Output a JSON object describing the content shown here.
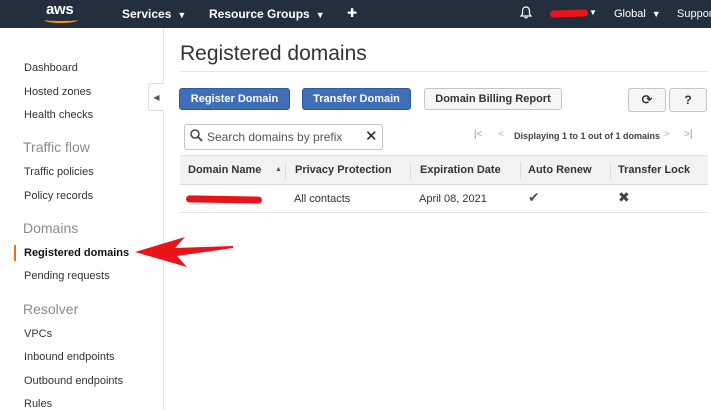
{
  "topnav": {
    "logo": "aws",
    "services_label": "Services",
    "resource_groups_label": "Resource Groups",
    "region_label": "Global",
    "support_label": "Suppor"
  },
  "sidebar": {
    "items": {
      "dashboard": "Dashboard",
      "hosted_zones": "Hosted zones",
      "health_checks": "Health checks",
      "traffic_flow_heading": "Traffic flow",
      "traffic_policies": "Traffic policies",
      "policy_records": "Policy records",
      "domains_heading": "Domains",
      "registered_domains": "Registered domains",
      "pending_requests": "Pending requests",
      "resolver_heading": "Resolver",
      "vpcs": "VPCs",
      "inbound_endpoints": "Inbound endpoints",
      "outbound_endpoints": "Outbound endpoints",
      "rules": "Rules"
    }
  },
  "main": {
    "title": "Registered domains",
    "buttons": {
      "register": "Register Domain",
      "transfer": "Transfer Domain",
      "billing": "Domain Billing Report"
    },
    "search": {
      "placeholder": "Search domains by prefix",
      "value": ""
    },
    "pagination_text": "Displaying 1 to 1 out of 1 domains",
    "table": {
      "columns": [
        "Domain Name",
        "Privacy Protection",
        "Expiration Date",
        "Auto Renew",
        "Transfer Lock"
      ],
      "rows": [
        {
          "domain_name": "",
          "privacy_protection": "All contacts",
          "expiration_date": "April 08, 2021",
          "auto_renew": "check",
          "transfer_lock": "cross"
        }
      ]
    }
  },
  "colors": {
    "topnav_bg": "#232f3e",
    "primary_button": "#3f6fb6",
    "active_marker": "#ec7211",
    "annotation_red": "#e8141a"
  }
}
